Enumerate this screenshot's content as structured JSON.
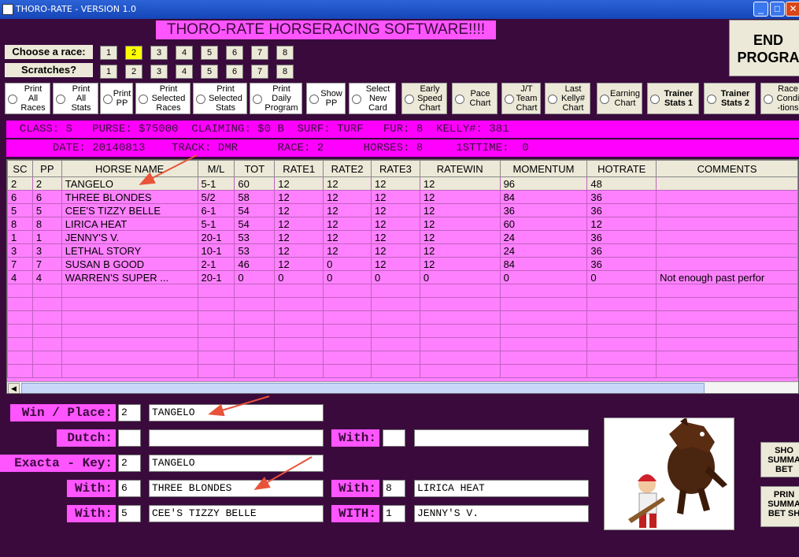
{
  "window": {
    "title": "THORO-RATE - VERSION 1.0"
  },
  "banner": "THORO-RATE HORSERACING SOFTWARE!!!!",
  "end_button": "END\nPROGRA",
  "race_label": "Choose  a race:",
  "scratch_label": "Scratches?",
  "race_buttons": [
    "1",
    "2",
    "3",
    "4",
    "5",
    "6",
    "7",
    "8"
  ],
  "scratch_buttons": [
    "1",
    "2",
    "3",
    "4",
    "5",
    "6",
    "7",
    "8"
  ],
  "selected_race": "2",
  "options": [
    "Print\nAll\nRaces",
    "Print\nAll\nStats",
    "Print\nPP",
    "Print\nSelected\nRaces",
    "Print\nSelected\nStats",
    "Print\nDaily\nProgram",
    "Show\nPP",
    "Select\nNew\nCard",
    "Early\nSpeed\nChart",
    "Pace\nChart",
    "J/T\nTeam\nChart",
    "Last\nKelly#\nChart",
    "Earning\nChart",
    "Trainer\nStats 1",
    "Trainer\nStats 2",
    "Race\nCondi\n-tions"
  ],
  "info1": "  CLASS: S   PURSE: $75000  CLAIMING: $0 B  SURF: TURF   FUR: 8  KELLY#: 381",
  "info2": "       DATE: 20140813    TRACK: DMR      RACE: 2      HORSES: 8     1STTIME:  0",
  "columns": [
    "SC",
    "PP",
    "HORSE NAME",
    "M/L",
    "TOT",
    "RATE1",
    "RATE2",
    "RATE3",
    "RATEWIN",
    "MOMENTUM",
    "HOTRATE",
    "COMMENTS"
  ],
  "rows": [
    [
      "2",
      "2",
      "TANGELO",
      "5-1",
      "60",
      "12",
      "12",
      "12",
      "12",
      "96",
      "48",
      ""
    ],
    [
      "6",
      "6",
      "THREE BLONDES",
      "5/2",
      "58",
      "12",
      "12",
      "12",
      "12",
      "84",
      "36",
      ""
    ],
    [
      "5",
      "5",
      "CEE'S TIZZY BELLE",
      "6-1",
      "54",
      "12",
      "12",
      "12",
      "12",
      "36",
      "36",
      ""
    ],
    [
      "8",
      "8",
      "LIRICA HEAT",
      "5-1",
      "54",
      "12",
      "12",
      "12",
      "12",
      "60",
      "12",
      ""
    ],
    [
      "1",
      "1",
      "JENNY'S V.",
      "20-1",
      "53",
      "12",
      "12",
      "12",
      "12",
      "24",
      "36",
      ""
    ],
    [
      "3",
      "3",
      "LETHAL STORY",
      "10-1",
      "53",
      "12",
      "12",
      "12",
      "12",
      "24",
      "36",
      ""
    ],
    [
      "7",
      "7",
      "SUSAN B GOOD",
      "2-1",
      "46",
      "12",
      "0",
      "12",
      "12",
      "84",
      "36",
      ""
    ],
    [
      "4",
      "4",
      "WARREN'S SUPER ...",
      "20-1",
      "0",
      "0",
      "0",
      "0",
      "0",
      "0",
      "0",
      "Not enough past perfor"
    ]
  ],
  "bets": {
    "win_place_label": "Win / Place:",
    "win_place_num": "2",
    "win_place_name": "TANGELO",
    "dutch_label": "Dutch:",
    "dutch_num": "",
    "dutch_name": "",
    "dutch_with_label": "With:",
    "dutch_with_num": "",
    "dutch_with_name": "",
    "exacta_label": "Exacta - Key:",
    "exacta_num": "2",
    "exacta_name": "TANGELO",
    "with1_label": "With:",
    "with1_num": "6",
    "with1_name": "THREE BLONDES",
    "with2_label": "With:",
    "with2_num": "8",
    "with2_name": "LIRICA HEAT",
    "with3_label": "With:",
    "with3_num": "5",
    "with3_name": "CEE'S TIZZY BELLE",
    "with4_label": "WITH:",
    "with4_num": "1",
    "with4_name": "JENNY'S V."
  },
  "side_buttons": [
    "SHO\nSUMMA\nBET",
    "PRIN\nSUMMA\nBET SH"
  ],
  "colors": {
    "background": "#3a0a3c",
    "magenta": "#ff00ff",
    "row_pink": "#ff80ff",
    "selected": "#ffff00",
    "arrow": "#e8533a"
  },
  "icons": {
    "app": "app-icon",
    "minimize": "minimize-icon",
    "maximize": "maximize-icon",
    "close": "close-icon",
    "picture": "horse-batter-cartoon"
  }
}
